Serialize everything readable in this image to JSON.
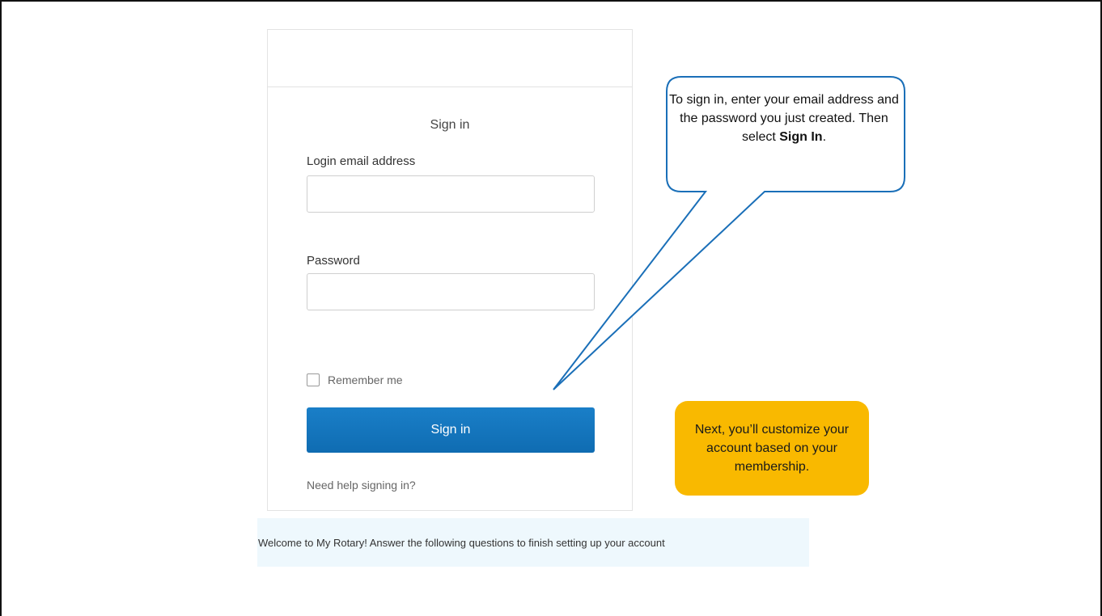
{
  "signin_card": {
    "title": "Sign in",
    "email_label": "Login email address",
    "email_value": "",
    "password_label": "Password",
    "password_value": "",
    "remember_label": "Remember me",
    "remember_checked": false,
    "signin_button": "Sign in",
    "help_link": "Need help signing in?"
  },
  "welcome_banner": {
    "text": "Welcome to My Rotary! Answer the following questions to finish setting up your account"
  },
  "callout": {
    "text_before": "To sign in, enter your email address and the password you just created. Then select ",
    "text_bold": "Sign In",
    "text_after": ".",
    "border_color": "#1a6fb8"
  },
  "note": {
    "text": "Next, you’ll customize your account based on your membership.",
    "background": "#f9b900"
  },
  "colors": {
    "primary_button": "#1478c0",
    "banner_background": "#eef8fd"
  }
}
